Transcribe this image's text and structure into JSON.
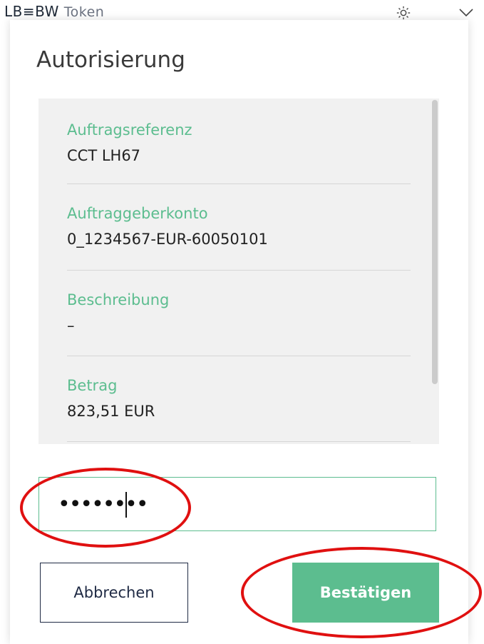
{
  "header": {
    "brand_text": "LB≡BW",
    "brand_sub": "Token",
    "settings_icon": "gear-icon",
    "collapse_icon": "chevron-down-icon"
  },
  "dialog": {
    "title": "Autorisierung",
    "details": [
      {
        "label": "Auftragsreferenz",
        "value": "CCT LH67"
      },
      {
        "label": "Auftraggeberkonto",
        "value": "0_1234567-EUR-60050101"
      },
      {
        "label": "Beschreibung",
        "value": "–"
      },
      {
        "label": "Betrag",
        "value": "823,51 EUR"
      }
    ],
    "password": {
      "masked_value": "••••••••"
    },
    "buttons": {
      "cancel_label": "Abbrechen",
      "confirm_label": "Bestätigen"
    }
  },
  "colors": {
    "accent": "#5cbd8f",
    "annotation": "#e01010",
    "button_border": "#1f2a44"
  }
}
